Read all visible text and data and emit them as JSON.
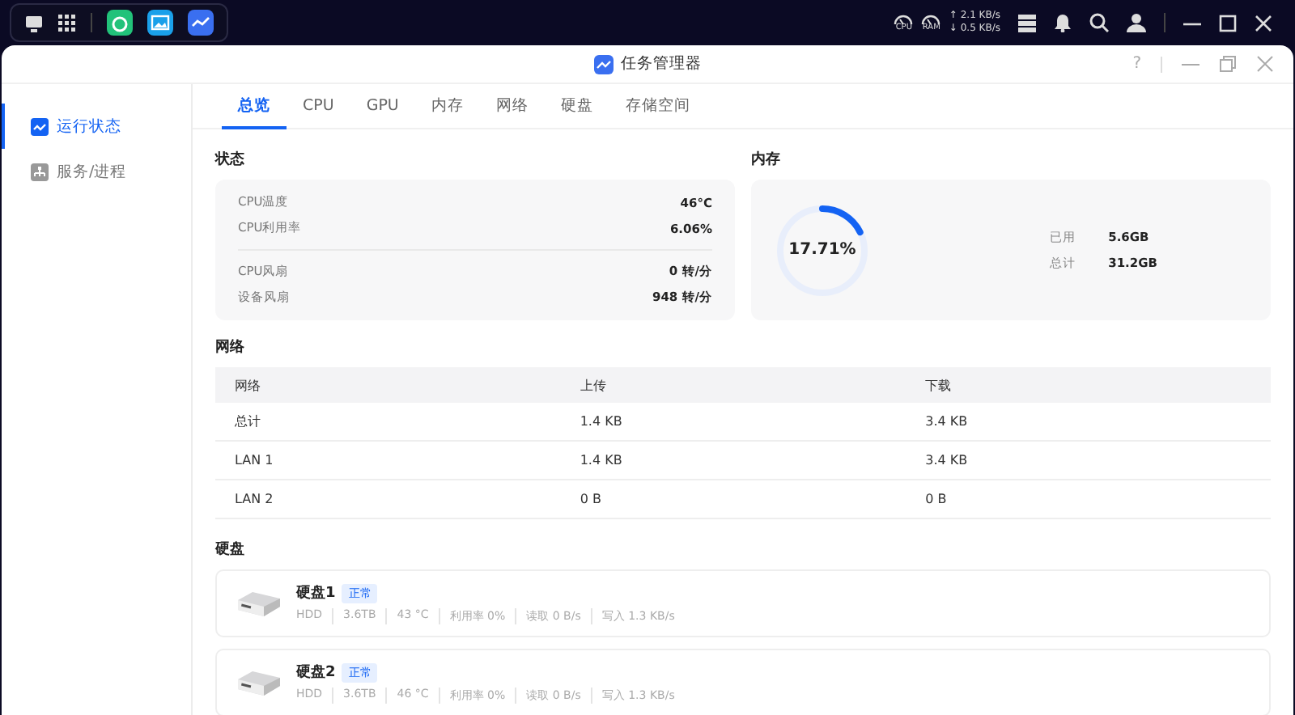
{
  "taskbar": {
    "gauges": [
      {
        "label": "CPU"
      },
      {
        "label": "RAM"
      }
    ],
    "upload_speed": "2.1 KB/s",
    "download_speed": "0.5 KB/s",
    "upload_arrow": "↑",
    "download_arrow": "↓"
  },
  "window": {
    "title": "任务管理器",
    "help": "?"
  },
  "sidebar": {
    "items": [
      {
        "label": "运行状态",
        "selected": true
      },
      {
        "label": "服务/进程",
        "selected": false
      }
    ]
  },
  "tabs": [
    {
      "label": "总览",
      "selected": true
    },
    {
      "label": "CPU",
      "selected": false
    },
    {
      "label": "GPU",
      "selected": false
    },
    {
      "label": "内存",
      "selected": false
    },
    {
      "label": "网络",
      "selected": false
    },
    {
      "label": "硬盘",
      "selected": false
    },
    {
      "label": "存储空间",
      "selected": false
    }
  ],
  "status": {
    "title": "状态",
    "groups": [
      [
        {
          "label": "CPU温度",
          "value": "46°C"
        },
        {
          "label": "CPU利用率",
          "value": "6.06%"
        }
      ],
      [
        {
          "label": "CPU风扇",
          "value": "0 转/分"
        },
        {
          "label": "设备风扇",
          "value": "948 转/分"
        }
      ]
    ]
  },
  "memory": {
    "title": "内存",
    "level": 0.1771,
    "percent": "17.71%",
    "stats": [
      {
        "label": "已用",
        "value": "5.6GB"
      },
      {
        "label": "总计",
        "value": "31.2GB"
      }
    ]
  },
  "network": {
    "title": "网络",
    "columns": [
      "网络",
      "上传",
      "下载"
    ],
    "rows": [
      [
        "总计",
        "1.4 KB",
        "3.4 KB"
      ],
      [
        "LAN 1",
        "1.4 KB",
        "3.4 KB"
      ],
      [
        "LAN 2",
        "0 B",
        "0 B"
      ]
    ]
  },
  "disks": {
    "title": "硬盘",
    "items": [
      {
        "name": "硬盘1",
        "status": "正常",
        "details": [
          "HDD",
          "3.6TB",
          "43 °C",
          "利用率 0%"
        ],
        "read": "读取 0 B/s",
        "write": "写入 1.3 KB/s"
      },
      {
        "name": "硬盘2",
        "status": "正常",
        "details": [
          "HDD",
          "3.6TB",
          "46 °C",
          "利用率 0%"
        ],
        "read": "读取 0 B/s",
        "write": "写入 1.3 KB/s"
      }
    ]
  }
}
